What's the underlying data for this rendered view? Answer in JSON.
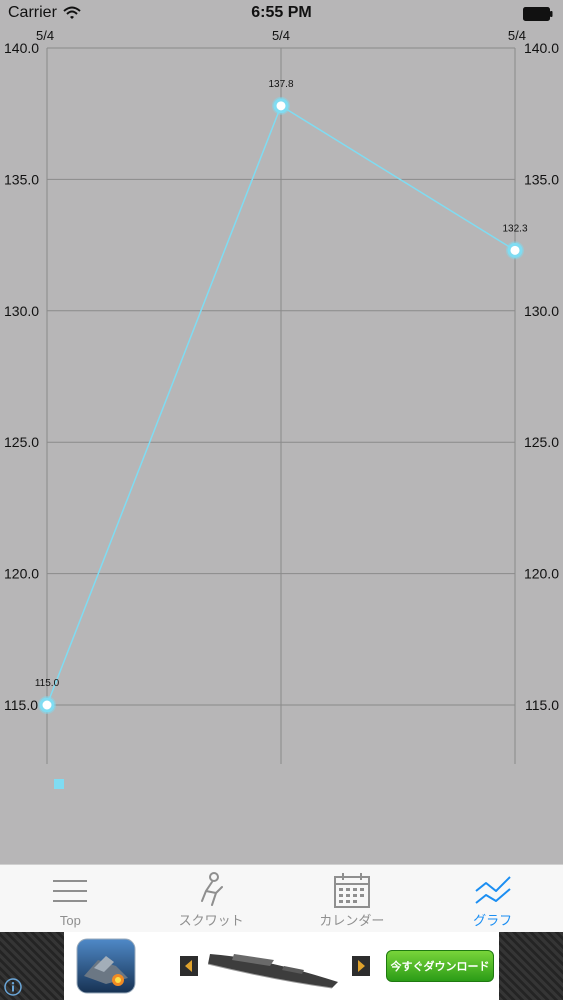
{
  "status_bar": {
    "carrier": "Carrier",
    "time": "6:55 PM"
  },
  "chart_data": {
    "type": "line",
    "x_labels": [
      "5/4",
      "5/4",
      "5/4"
    ],
    "values": [
      115.0,
      137.8,
      132.3
    ],
    "y_ticks": [
      115.0,
      120.0,
      125.0,
      130.0,
      135.0,
      140.0
    ],
    "y_tick_labels": [
      "115.0",
      "120.0",
      "125.0",
      "130.0",
      "135.0",
      "140.0"
    ],
    "ylim": [
      113.6,
      140.0
    ],
    "value_labels": [
      "115.0",
      "137.8",
      "132.3"
    ],
    "line_color": "#7fdcf2",
    "marker_fill": "#ffffff",
    "marker_stroke": "#7fdcf2",
    "grid_color": "#8a8a8a",
    "grid": true,
    "legend_swatch_color": "#7fdcf2"
  },
  "tab_bar": {
    "tabs": [
      {
        "label": "Top",
        "icon": "menu-lines-icon",
        "active": false
      },
      {
        "label": "スクワット",
        "icon": "squat-figure-icon",
        "active": false
      },
      {
        "label": "カレンダー",
        "icon": "calendar-icon",
        "active": false
      },
      {
        "label": "グラフ",
        "icon": "graph-lines-icon",
        "active": true
      }
    ],
    "active_color": "#1b8ef2",
    "inactive_color": "#8f8f8f"
  },
  "ad": {
    "cta_label": "今すぐダウンロード",
    "info_icon": "info-icon"
  }
}
